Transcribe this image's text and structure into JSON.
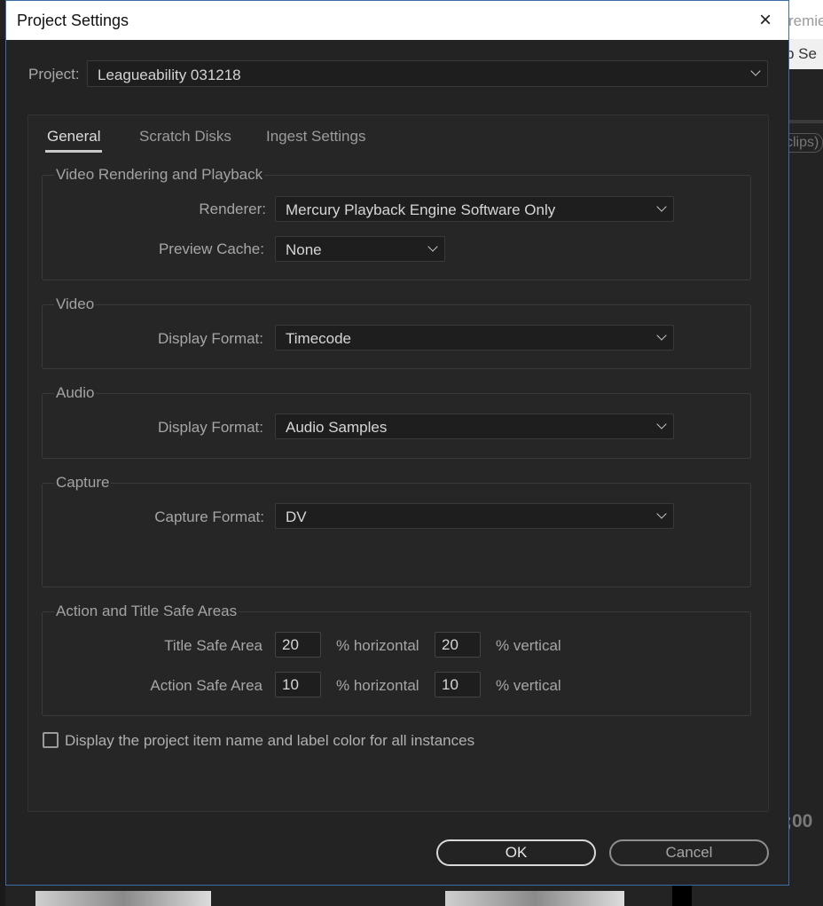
{
  "background_app": {
    "title_fragment": "remie",
    "menu_fragment": "p  Se",
    "panel_fragment": "clips)",
    "timecode_fragment": ";00"
  },
  "dialog": {
    "title": "Project Settings",
    "close_icon": "×"
  },
  "project": {
    "label": "Project:",
    "value": "Leagueability 031218"
  },
  "tabs": [
    {
      "label": "General",
      "active": true
    },
    {
      "label": "Scratch Disks",
      "active": false
    },
    {
      "label": "Ingest Settings",
      "active": false
    }
  ],
  "video_rendering": {
    "title": "Video Rendering and Playback",
    "renderer_label": "Renderer:",
    "renderer_value": "Mercury Playback Engine Software Only",
    "preview_cache_label": "Preview Cache:",
    "preview_cache_value": "None"
  },
  "video": {
    "title": "Video",
    "display_format_label": "Display Format:",
    "display_format_value": "Timecode"
  },
  "audio": {
    "title": "Audio",
    "display_format_label": "Display Format:",
    "display_format_value": "Audio Samples"
  },
  "capture": {
    "title": "Capture",
    "capture_format_label": "Capture Format:",
    "capture_format_value": "DV"
  },
  "safe_areas": {
    "title": "Action and Title Safe Areas",
    "title_safe_label": "Title Safe Area",
    "title_safe_horizontal": "20",
    "title_safe_vertical": "20",
    "action_safe_label": "Action Safe Area",
    "action_safe_horizontal": "10",
    "action_safe_vertical": "10",
    "horizontal_unit": "% horizontal",
    "vertical_unit": "% vertical"
  },
  "display_item_checkbox": {
    "label": "Display the project item name and label color for all instances",
    "checked": false
  },
  "buttons": {
    "ok": "OK",
    "cancel": "Cancel"
  },
  "colors": {
    "panel_bg": "#232323",
    "title_bar": "#ffffff",
    "dialog_border": "#3b6ea5"
  }
}
